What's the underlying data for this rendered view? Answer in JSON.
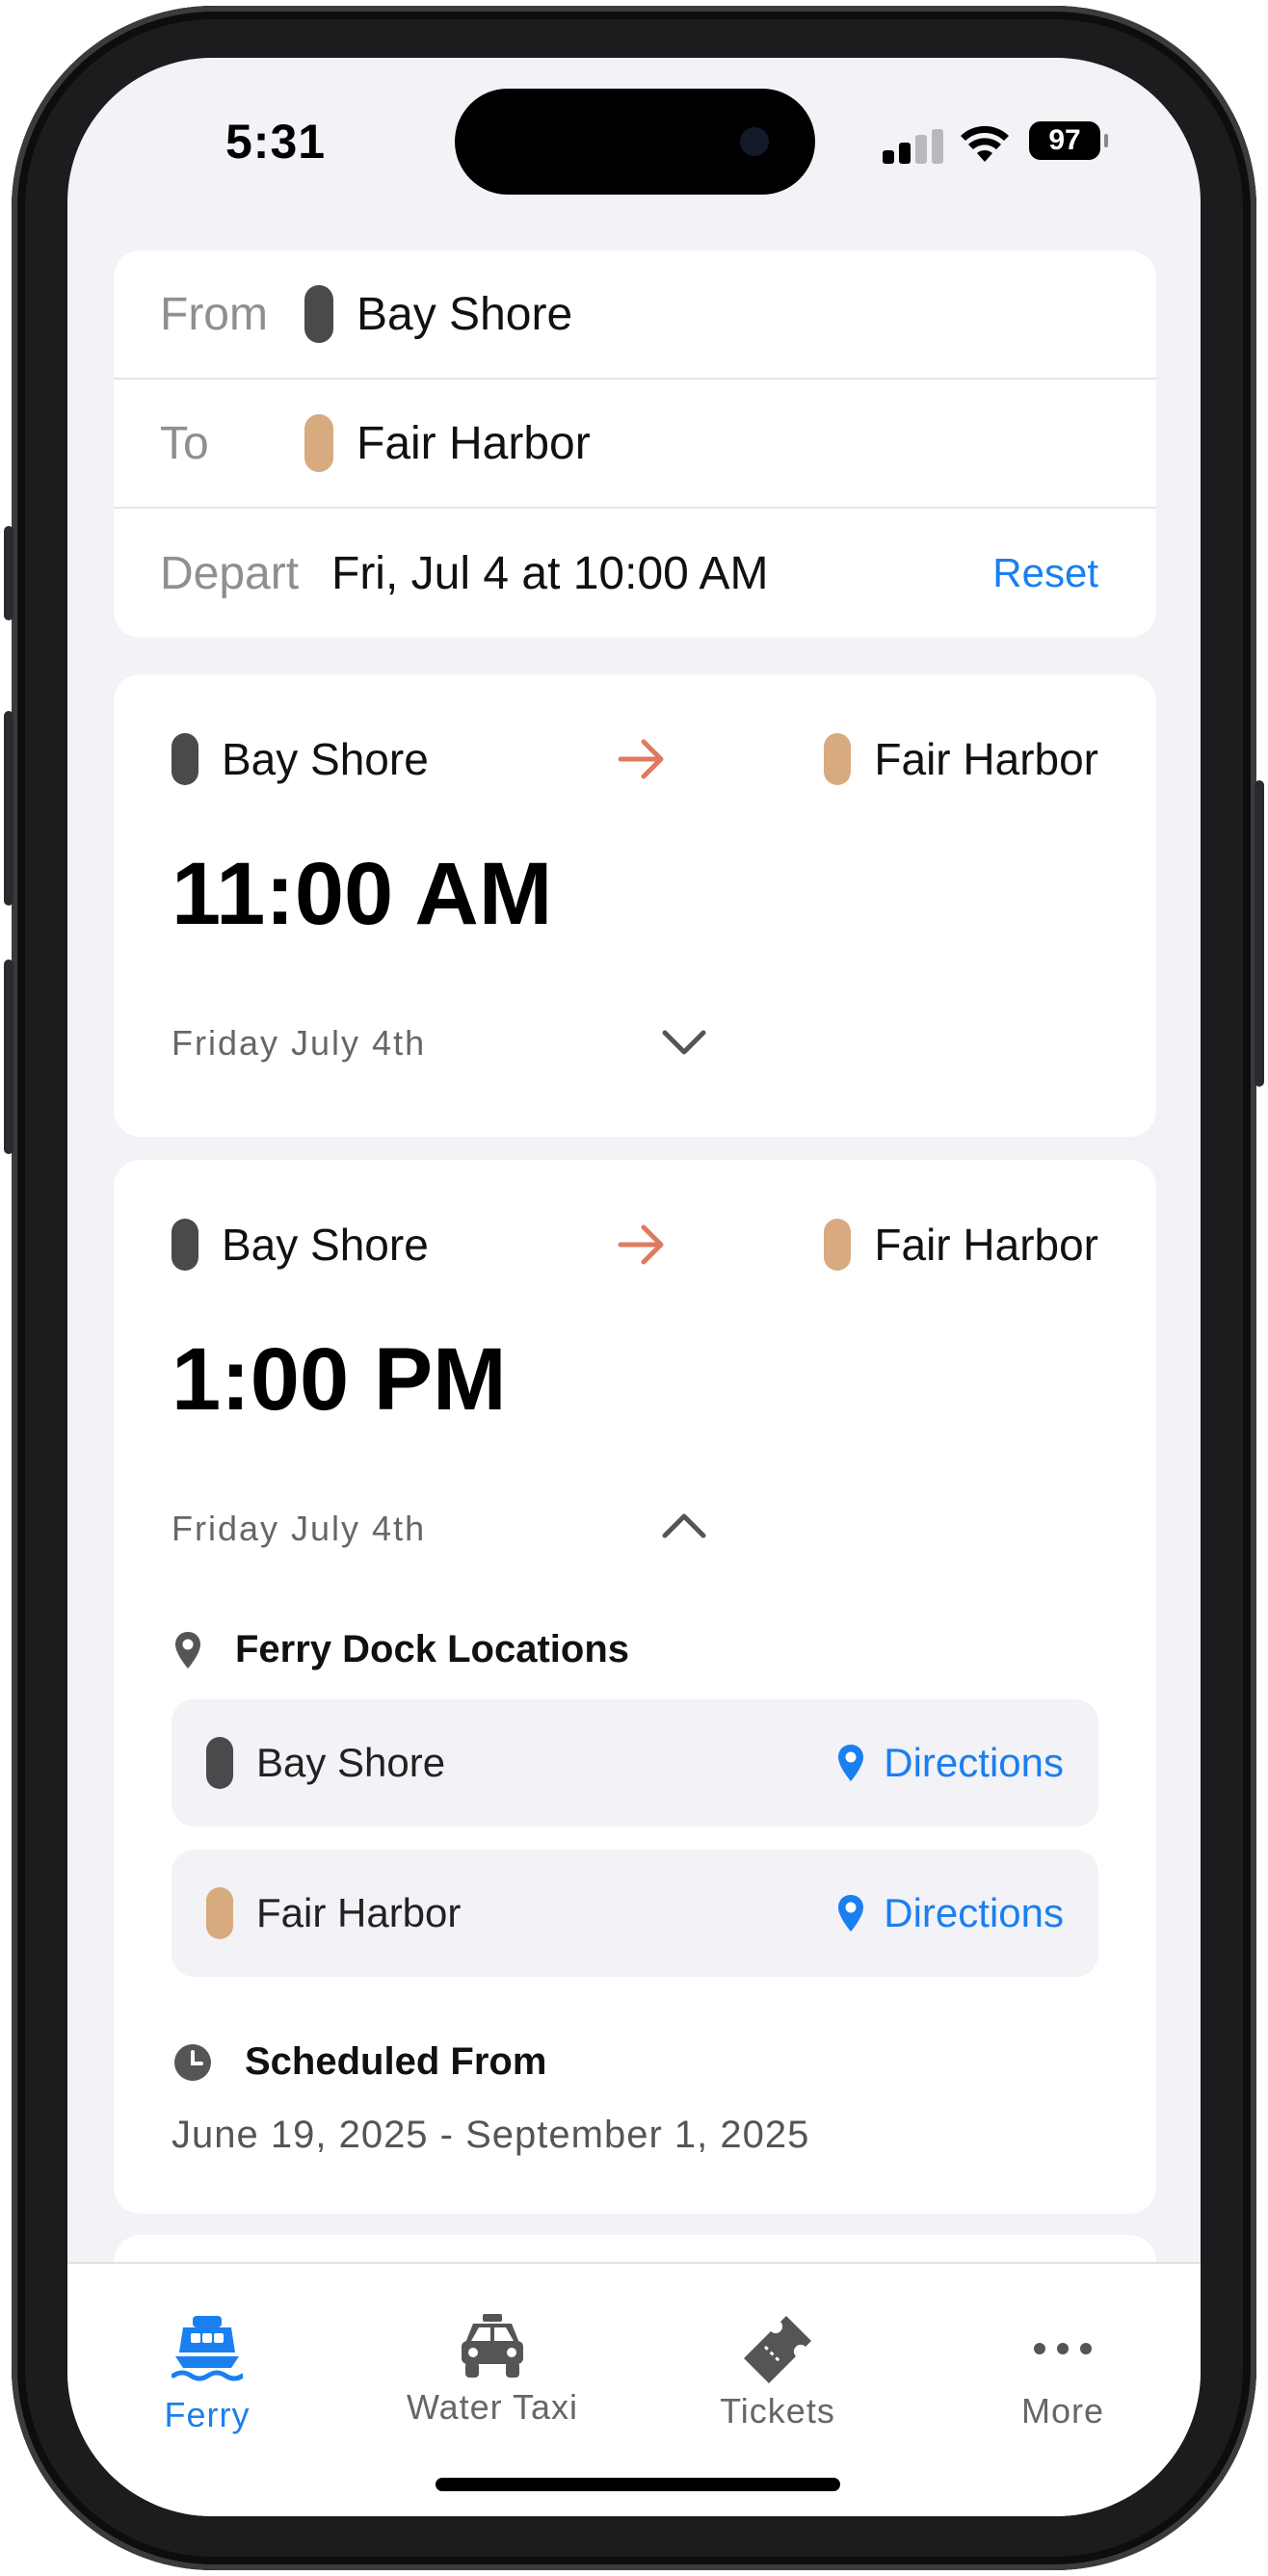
{
  "status_bar": {
    "time": "5:31",
    "battery": "97"
  },
  "search": {
    "from_label": "From",
    "from_value": "Bay Shore",
    "to_label": "To",
    "to_value": "Fair Harbor",
    "depart_label": "Depart",
    "depart_value": "Fri, Jul 4 at 10:00 AM",
    "reset_label": "Reset"
  },
  "trips": [
    {
      "from": "Bay Shore",
      "to": "Fair Harbor",
      "time": "11:00 AM",
      "date": "Friday July 4th",
      "expanded": false
    },
    {
      "from": "Bay Shore",
      "to": "Fair Harbor",
      "time": "1:00 PM",
      "date": "Friday July 4th",
      "expanded": true,
      "dock_section_title": "Ferry Dock Locations",
      "docks": [
        {
          "name": "Bay Shore",
          "action": "Directions"
        },
        {
          "name": "Fair Harbor",
          "action": "Directions"
        }
      ],
      "schedule_title": "Scheduled From",
      "schedule_range": "June 19, 2025 - September 1, 2025"
    }
  ],
  "tabs": [
    {
      "label": "Ferry",
      "icon": "ferry-icon",
      "active": true
    },
    {
      "label": "Water Taxi",
      "icon": "taxi-icon",
      "active": false
    },
    {
      "label": "Tickets",
      "icon": "ticket-icon",
      "active": false
    },
    {
      "label": "More",
      "icon": "more-dots-icon",
      "active": false
    }
  ],
  "colors": {
    "accent": "#1a7ff0",
    "origin_pill": "#4a4a4c",
    "destination_pill": "#d8aa80",
    "route_arrow": "#e07a5f",
    "background": "#f2f2f7"
  }
}
